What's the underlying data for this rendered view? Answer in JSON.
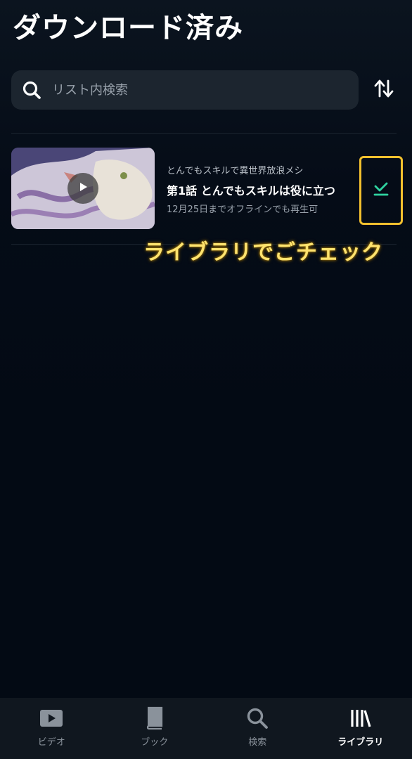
{
  "header": {
    "title": "ダウンロード済み"
  },
  "search": {
    "placeholder": "リスト内検索"
  },
  "items": [
    {
      "series": "とんでもスキルで異世界放浪メシ",
      "episode_title": "第1話 とんでもスキルは役に立つ",
      "expiry": "12月25日までオフラインでも再生可"
    }
  ],
  "annotation": {
    "text": "ライブラリでごチェック"
  },
  "tabs": [
    {
      "label": "ビデオ",
      "icon": "video-icon",
      "active": false
    },
    {
      "label": "ブック",
      "icon": "book-icon",
      "active": false
    },
    {
      "label": "検索",
      "icon": "search-icon",
      "active": false
    },
    {
      "label": "ライブラリ",
      "icon": "library-icon",
      "active": true
    }
  ],
  "colors": {
    "background": "#030a14",
    "accent_green": "#2fd3a0",
    "annotation_yellow": "#f2c12e"
  }
}
